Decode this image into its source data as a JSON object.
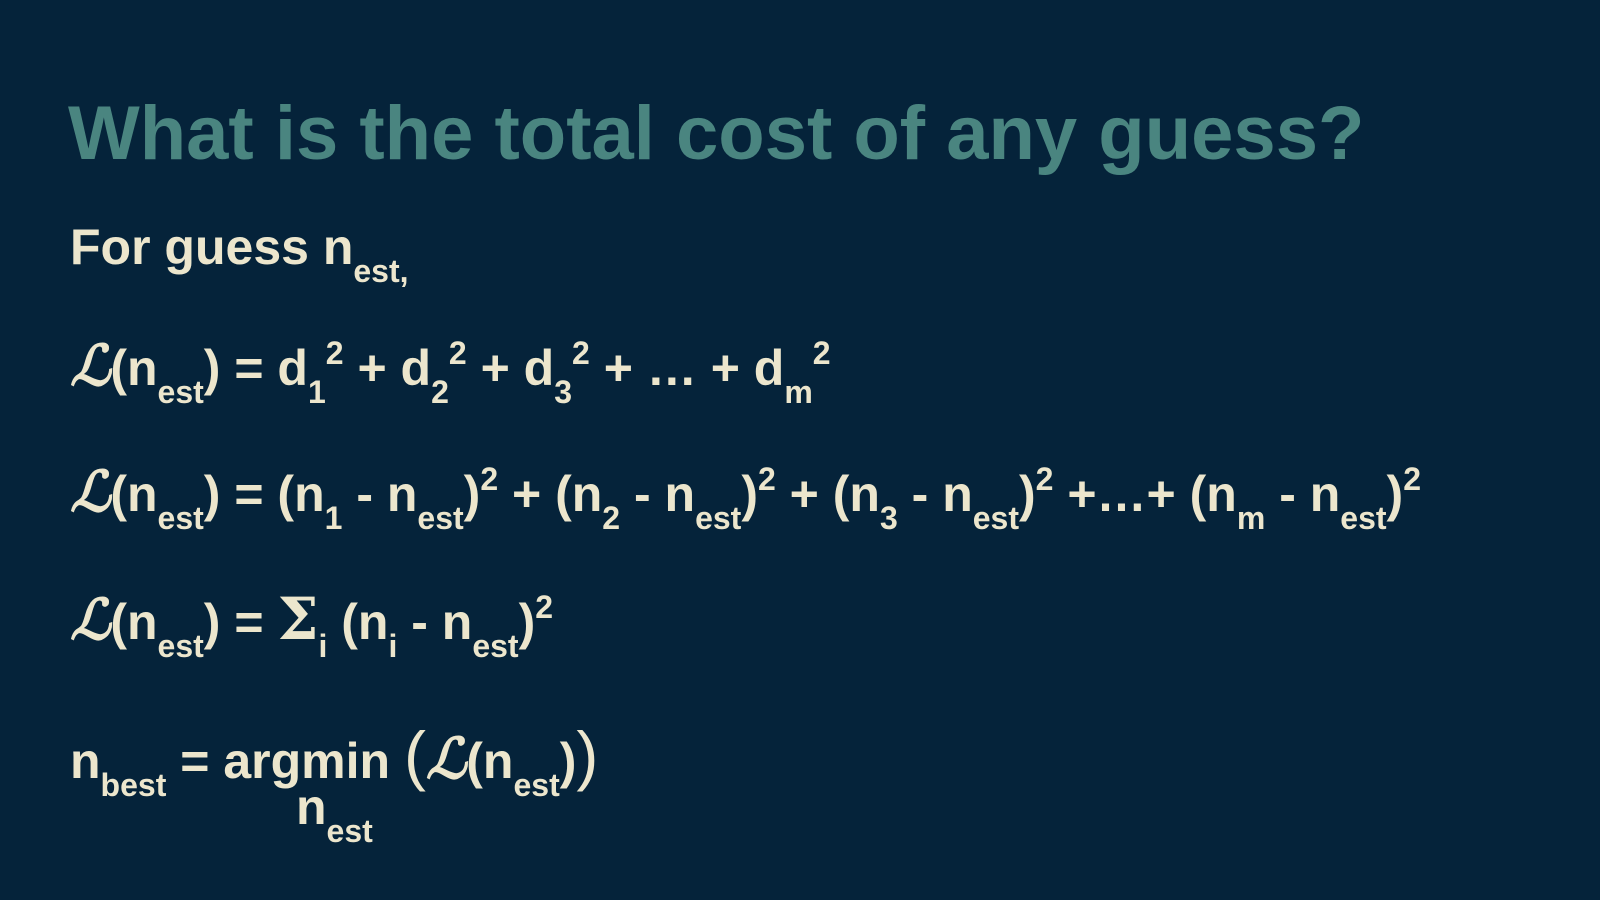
{
  "slide": {
    "title": "What is the total cost of any guess?",
    "colors": {
      "background": "#05233a",
      "title": "#4a8580",
      "text": "#ece6cd"
    },
    "intro": {
      "prefix": "For guess n",
      "subscript": "est,"
    },
    "symbols": {
      "loss": "ℒ",
      "sigma": "Σ",
      "est": "est",
      "best": "best",
      "square": "2",
      "i": "i",
      "m": "m"
    },
    "eq1": {
      "d_subs": [
        "1",
        "2",
        "3"
      ],
      "ellipsis": "…",
      "last_sub": "m"
    },
    "eq2": {
      "n_subs": [
        "1",
        "2",
        "3"
      ],
      "ellipsis": "+…+",
      "last_sub": "m"
    },
    "eq4": {
      "lhs": "n",
      "operator": "argmin",
      "under_label": "n"
    }
  }
}
